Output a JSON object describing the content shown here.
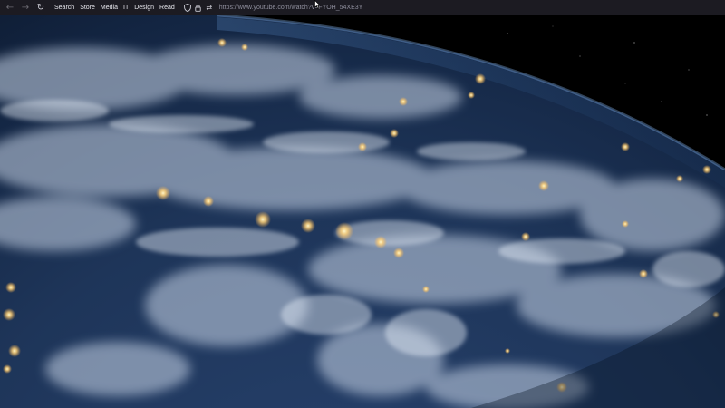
{
  "toolbar": {
    "bookmarks": [
      "Search",
      "Store",
      "Media",
      "IT",
      "Design",
      "Read"
    ],
    "url": "https://www.youtube.com/watch?v=FYOH_54XE3Y"
  },
  "extensions": {
    "badge_count": "41",
    "colors": {
      "ext_blue": "#1f6fb8",
      "ext_red": "#d23b3b",
      "ext_orange": "#e86a2a",
      "ext_teal": "#1f6f9c"
    }
  },
  "video": {
    "description_icon": "earth-from-space-image"
  }
}
